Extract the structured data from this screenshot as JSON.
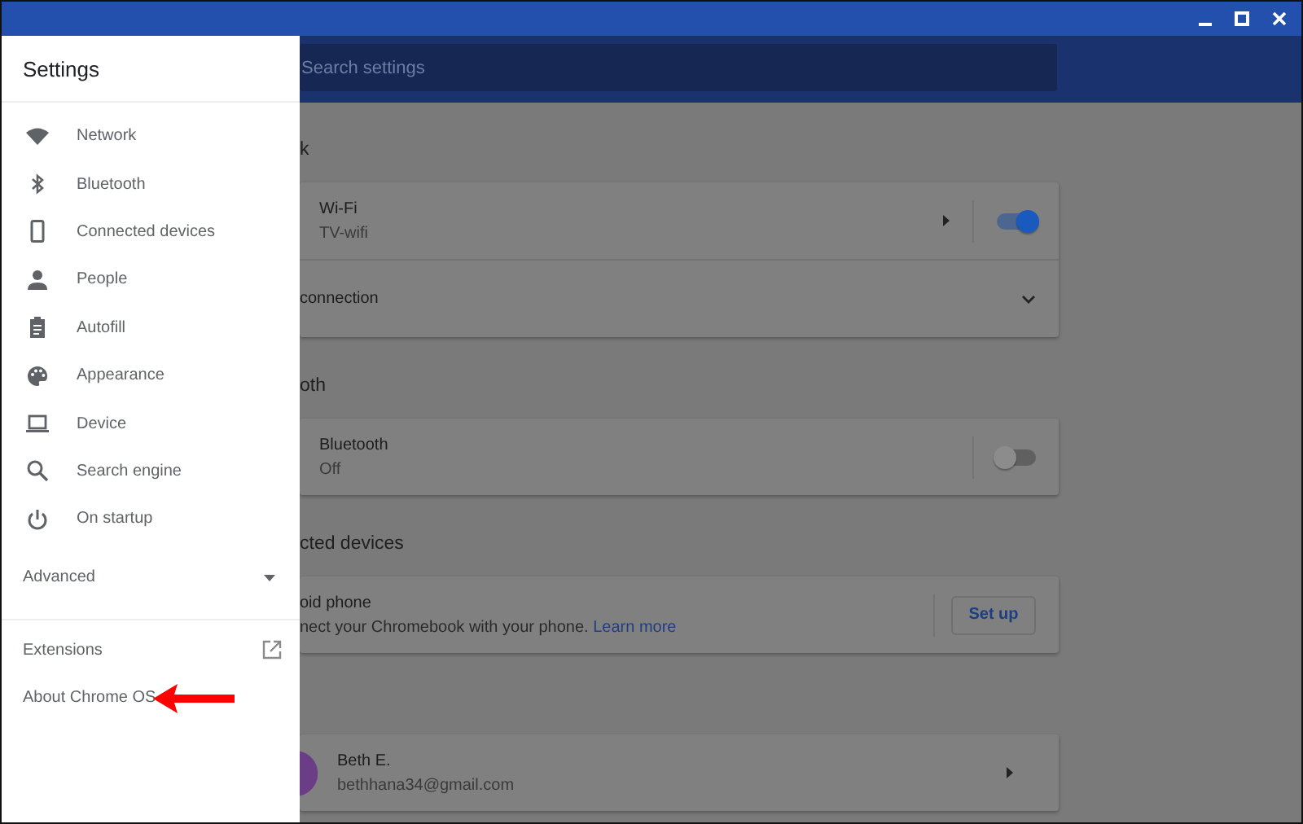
{
  "search": {
    "placeholder": "Search settings"
  },
  "drawer": {
    "title": "Settings",
    "items": [
      {
        "kind": "network",
        "label": "Network"
      },
      {
        "kind": "bluetooth",
        "label": "Bluetooth"
      },
      {
        "kind": "phone",
        "label": "Connected devices"
      },
      {
        "kind": "person",
        "label": "People"
      },
      {
        "kind": "clipboard",
        "label": "Autofill"
      },
      {
        "kind": "palette",
        "label": "Appearance"
      },
      {
        "kind": "laptop",
        "label": "Device"
      },
      {
        "kind": "search",
        "label": "Search engine"
      },
      {
        "kind": "power",
        "label": "On startup"
      }
    ],
    "advanced": {
      "label": "Advanced",
      "expanded": false
    },
    "links": [
      {
        "label": "Extensions",
        "external": true
      },
      {
        "label": "About Chrome OS",
        "external": false
      }
    ]
  },
  "sections": [
    {
      "heading": "k",
      "rows": [
        {
          "kind": "toggle",
          "title": "Wi-Fi",
          "subtitle": "TV-wifi",
          "on": true,
          "submenu": true
        },
        {
          "kind": "expand",
          "title": "connection",
          "expanded": false
        }
      ]
    },
    {
      "heading": "oth",
      "rows": [
        {
          "kind": "toggle",
          "title": "Bluetooth",
          "subtitle": "Off",
          "on": false,
          "submenu": false
        }
      ]
    },
    {
      "heading": "cted devices",
      "rows": [
        {
          "kind": "action",
          "title": "oid phone",
          "description": "nect your Chromebook with your phone.",
          "link": "Learn more",
          "button": "Set up"
        }
      ]
    },
    {
      "rows": [
        {
          "kind": "account",
          "title": "Beth E.",
          "subtitle": "bethhana34@gmail.com",
          "color": "#6b3d86"
        }
      ]
    }
  ]
}
